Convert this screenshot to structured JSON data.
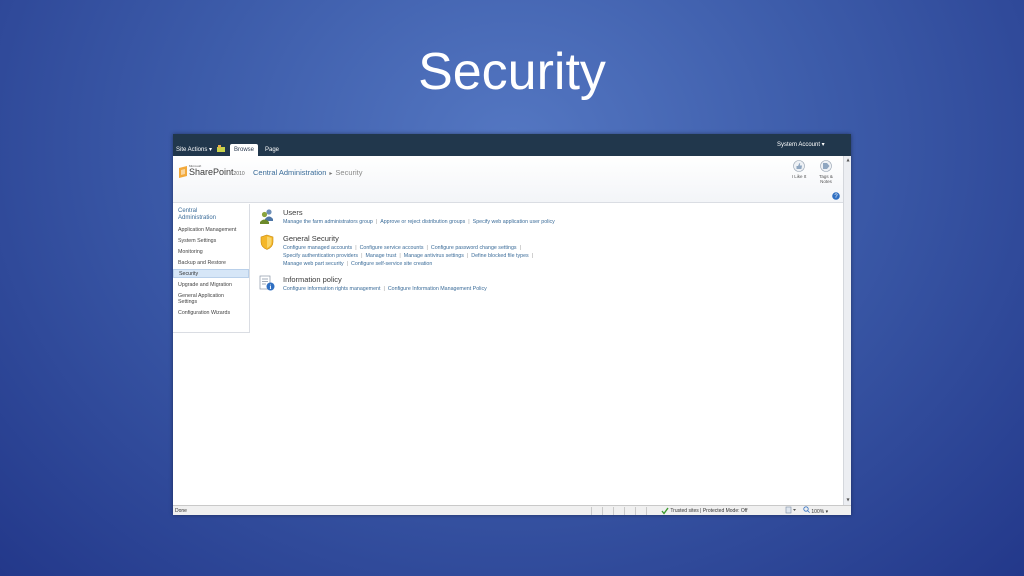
{
  "slide": {
    "title": "Security"
  },
  "ribbon": {
    "site_actions": "Site Actions ▾",
    "tabs": [
      {
        "label": "Browse"
      },
      {
        "label": "Page"
      }
    ],
    "account": "System Account ▾"
  },
  "header": {
    "logo_microsoft": "Microsoft",
    "logo_name": "SharePoint",
    "logo_year": "2010",
    "breadcrumb": {
      "root": "Central Administration",
      "separator": "▸",
      "current": "Security"
    },
    "i_like_it": "I Like It",
    "tags_notes_1": "Tags &",
    "tags_notes_2": "Notes"
  },
  "left_nav": {
    "header_line1": "Central",
    "header_line2": "Administration",
    "items": [
      {
        "label": "Application Management"
      },
      {
        "label": "System Settings"
      },
      {
        "label": "Monitoring"
      },
      {
        "label": "Backup and Restore"
      },
      {
        "label": "Security"
      },
      {
        "label": "Upgrade and Migration"
      },
      {
        "label": "General Application"
      },
      {
        "label": "Settings"
      },
      {
        "label": "Configuration Wizards"
      }
    ]
  },
  "sections": [
    {
      "title": "Users",
      "icon": "users-icon",
      "links": [
        [
          "Manage the farm administrators group",
          "Approve or reject distribution groups",
          "Specify web application user policy"
        ]
      ]
    },
    {
      "title": "General Security",
      "icon": "shield-icon",
      "links": [
        [
          "Configure managed accounts",
          "Configure service accounts",
          "Configure password change settings"
        ],
        [
          "Specify authentication providers",
          "Manage trust",
          "Manage antivirus settings",
          "Define blocked file types"
        ],
        [
          "Manage web part security",
          "Configure self-service site creation"
        ]
      ]
    },
    {
      "title": "Information policy",
      "icon": "information-policy-icon",
      "links": [
        [
          "Configure information rights management",
          "Configure Information Management Policy"
        ]
      ]
    }
  ],
  "separator": "|",
  "status_bar": {
    "done": "Done",
    "trusted": "Trusted sites | Protected Mode: Off",
    "zoom": "100%"
  },
  "colors": {
    "link": "#3b6c99",
    "ribbon": "#21374c",
    "selected_nav": "#d6e6f7"
  }
}
